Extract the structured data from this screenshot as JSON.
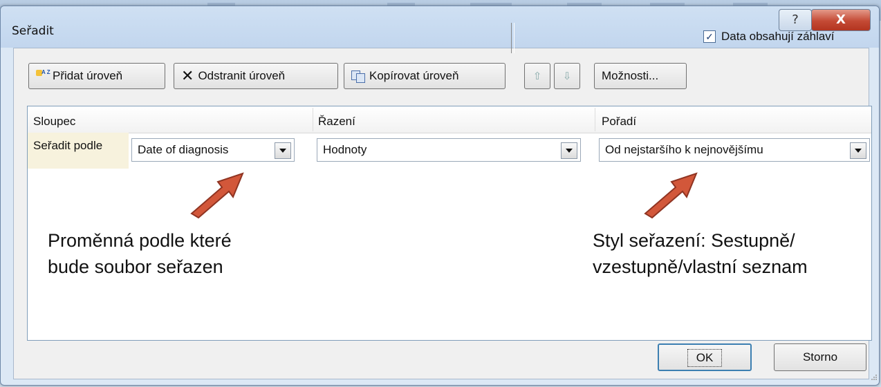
{
  "window": {
    "title": "Seřadit",
    "help_label": "?",
    "close_label": "X"
  },
  "toolbar": {
    "add_level": "Přidat úroveň",
    "delete_level": "Odstranit úroveň",
    "copy_level": "Kopírovat úroveň",
    "move_up": "⇧",
    "move_down": "⇩",
    "options": "Možnosti...",
    "header_checkbox": {
      "label": "Data obsahují záhlaví",
      "checked": true
    }
  },
  "grid": {
    "columns": [
      "Sloupec",
      "Řazení",
      "Pořadí"
    ],
    "rows": [
      {
        "label": "Seřadit podle",
        "column": "Date of diagnosis",
        "sort_on": "Hodnoty",
        "order": "Od nejstaršího k nejnovějšímu"
      }
    ]
  },
  "annotations": {
    "left": "Proměnná podle které\nbude soubor seřazen",
    "right": "Styl seřazení: Sestupně/\nvzestupně/vlastní seznam",
    "arrow_color": "#d2573a"
  },
  "buttons": {
    "ok": "OK",
    "cancel": "Storno"
  }
}
